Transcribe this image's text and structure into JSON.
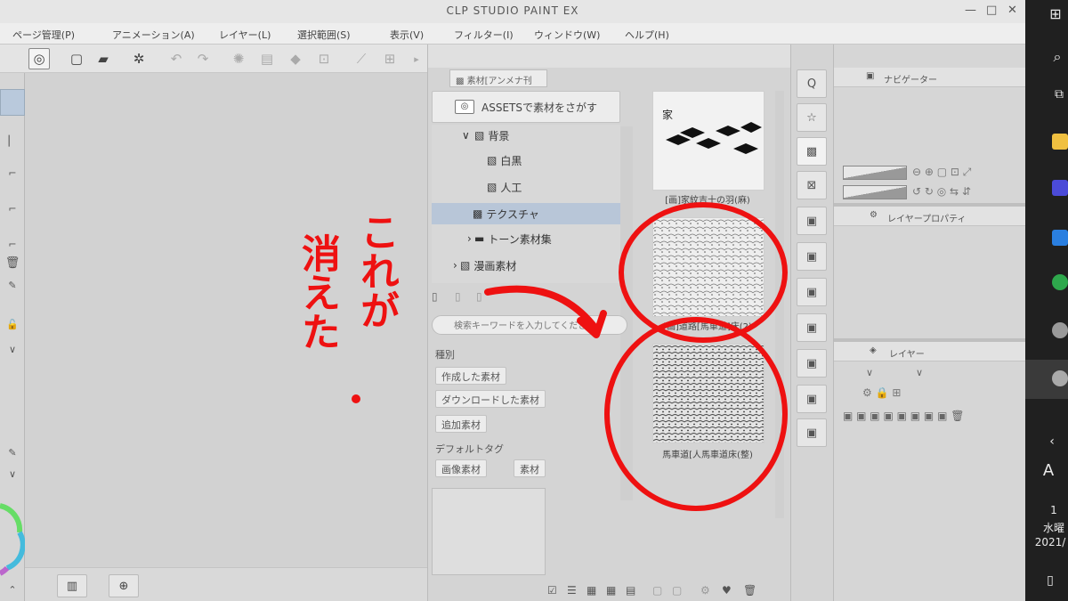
{
  "window": {
    "title": "CLP STUDIO PAINT EX",
    "controls": [
      "—",
      "□",
      "✕"
    ]
  },
  "menubar": {
    "items": [
      "ページ管理(P)",
      "アニメーション(A)",
      "レイヤー(L)",
      "選択範囲(S)",
      "表示(V)",
      "フィルター(I)",
      "ウィンドウ(W)",
      "ヘルプ(H)"
    ]
  },
  "material_panel": {
    "tab_label": "素材[アンメナ刊",
    "assets_button": "ASSETSで素材をさがす",
    "tree": [
      {
        "label": "背景",
        "prefix": "∨"
      },
      {
        "label": "白黒",
        "prefix": ""
      },
      {
        "label": "人工",
        "prefix": ""
      },
      {
        "label": "テクスチャ",
        "prefix": ""
      },
      {
        "label": "トーン素材集",
        "prefix": "›"
      },
      {
        "label": "漫画素材",
        "prefix": "›"
      }
    ],
    "search_placeholder": "検索キーワードを入力してください",
    "filter_heading_type": "種別",
    "filter_chips_type": [
      "作成した素材",
      "ダウンロードした素材",
      "追加素材"
    ],
    "filter_heading_tag": "デフォルトタグ",
    "filter_chips_tag": [
      "画像素材",
      "素材"
    ],
    "thumbnails": [
      {
        "caption": "[画]家紋吉十の羽(麻)"
      },
      {
        "caption": "[画]道路[馬車道]床(2)"
      },
      {
        "caption": "馬車道[人馬車道床(整)"
      }
    ]
  },
  "right_panel": {
    "nav_tab": "ナビゲーター",
    "layer_prop_tab": "レイヤープロパティ",
    "layer_tab": "レイヤー"
  },
  "taskbar": {
    "time_partial": "1",
    "day_partial": "水曜",
    "date_partial": "2021/",
    "letter": "A"
  },
  "annotations": {
    "text_top": "これが",
    "text_bottom": "消えた",
    "color": "#ee1111"
  }
}
